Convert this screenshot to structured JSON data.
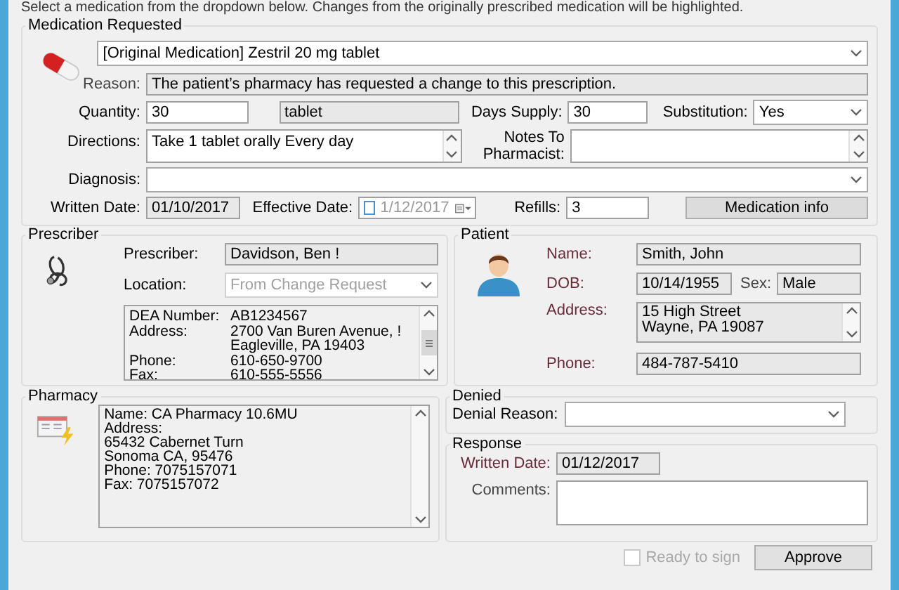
{
  "instruction": "Select a medication from the dropdown below. Changes from the originally prescribed medication will be highlighted.",
  "medication": {
    "title": "Medication Requested",
    "drug": {
      "value": "[Original Medication] Zestril 20 mg tablet"
    },
    "reason": {
      "label": "Reason:",
      "value": "The patient’s pharmacy has requested a change to this prescription."
    },
    "quantity": {
      "label": "Quantity:",
      "value": "30"
    },
    "unit": {
      "value": "tablet"
    },
    "days_supply": {
      "label": "Days Supply:",
      "value": "30"
    },
    "substitution": {
      "label": "Substitution:",
      "value": "Yes"
    },
    "directions": {
      "label": "Directions:",
      "value": "Take 1 tablet orally Every day"
    },
    "notes": {
      "label": "Notes To Pharmacist:"
    },
    "diagnosis": {
      "label": "Diagnosis:"
    },
    "written_date": {
      "label": "Written Date:",
      "value": "01/10/2017"
    },
    "effective_date": {
      "label": "Effective Date:",
      "value": "1/12/2017",
      "checked": false
    },
    "refills": {
      "label": "Refills:",
      "value": "3"
    },
    "info_button": {
      "label": "Medication info"
    }
  },
  "prescriber": {
    "title": "Prescriber",
    "prescriber": {
      "label": "Prescriber:",
      "value": "Davidson, Ben !"
    },
    "location": {
      "label": "Location:",
      "value": "From Change Request",
      "disabled": true
    },
    "details": [
      {
        "label": "DEA Number:",
        "lines": [
          "AB1234567"
        ]
      },
      {
        "label": "Address:",
        "lines": [
          "2700 Van Buren Avenue, !",
          "Eagleville, PA 19403"
        ]
      },
      {
        "label": "Phone:",
        "lines": [
          "610-650-9700"
        ]
      },
      {
        "label": "Fax:",
        "lines": [
          "610-555-5556"
        ]
      }
    ]
  },
  "patient": {
    "title": "Patient",
    "name": {
      "label": "Name:",
      "value": "Smith, John"
    },
    "dob": {
      "label": "DOB:",
      "value": "10/14/1955"
    },
    "sex": {
      "label": "Sex:",
      "value": "Male"
    },
    "address": {
      "label": "Address:",
      "lines": [
        "15 High Street",
        "Wayne, PA 19087"
      ]
    },
    "phone": {
      "label": "Phone:",
      "value": "484-787-5410"
    }
  },
  "pharmacy": {
    "title": "Pharmacy",
    "lines": [
      "Name: CA Pharmacy 10.6MU",
      "Address:",
      "65432 Cabernet Turn",
      "Sonoma CA, 95476",
      "Phone: 7075157071",
      "Fax: 7075157072"
    ]
  },
  "denied": {
    "title": "Denied",
    "reason": {
      "label": "Denial Reason:"
    }
  },
  "response": {
    "title": "Response",
    "written_date": {
      "label": "Written Date:",
      "value": "01/12/2017"
    },
    "comments": {
      "label": "Comments:"
    }
  },
  "footer": {
    "ready": {
      "label": "Ready to sign",
      "checked": false,
      "disabled": true
    },
    "approve": {
      "label": "Approve"
    }
  }
}
